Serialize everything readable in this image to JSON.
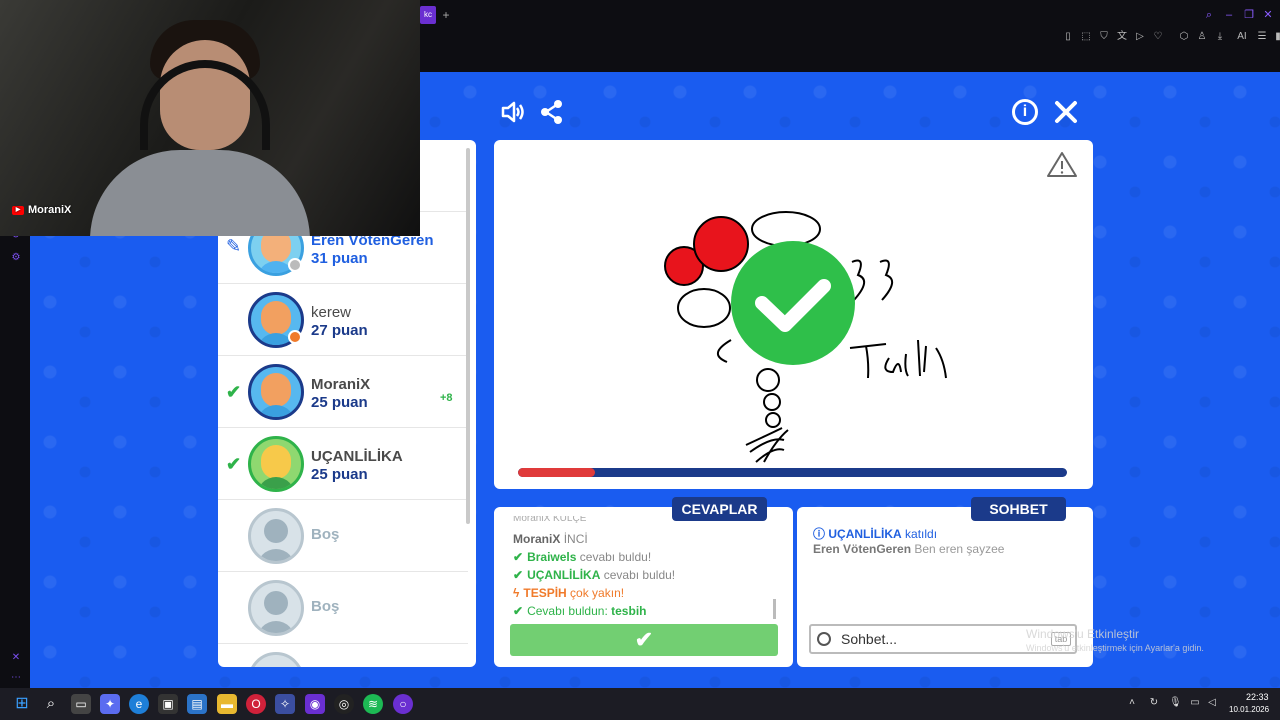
{
  "webcam": {
    "channel_name": "MoraniX"
  },
  "browser": {
    "tab_chip": "kc",
    "tab_plus": "+",
    "toolbar_ai": "AI"
  },
  "players": [
    {
      "name": "Eren VötenGeren",
      "score": "31 puan",
      "state": "drawing"
    },
    {
      "name": "kerew",
      "score": "27 puan",
      "state": "none"
    },
    {
      "name": "MoraniX",
      "score": "25 puan",
      "state": "guessed",
      "bonus": "+8"
    },
    {
      "name": "UÇANLİLİKA",
      "score": "25 puan",
      "state": "guessed"
    },
    {
      "name": "Boş"
    },
    {
      "name": "Boş"
    }
  ],
  "canvas": {
    "progress_fraction": 0.14,
    "drawing_word": "Taşlı",
    "drawing_number": "33"
  },
  "tabs": {
    "answers": "CEVAPLAR",
    "chat": "SOHBET"
  },
  "answers": {
    "partial_top": "MoraniX KÜLÇE",
    "messages": [
      {
        "name": "MoraniX",
        "text": "İNCİ",
        "type": "plain"
      },
      {
        "name": "Braiwels",
        "text": "cevabı buldu!",
        "type": "found"
      },
      {
        "name": "UÇANLİLİKA",
        "text": "cevabı buldu!",
        "type": "found"
      },
      {
        "name": "TESPİH",
        "text": "çok yakın!",
        "type": "close"
      },
      {
        "prefix": "Cevabı buldun:",
        "name": "tesbih",
        "type": "you_found"
      }
    ]
  },
  "chat": {
    "messages": [
      {
        "name": "UÇANLİLİKA",
        "text": "katıldı"
      },
      {
        "name": "Eren VötenGeren",
        "text": "Ben eren şayzee"
      }
    ],
    "placeholder": "Sohbet...",
    "tab_key": "tab"
  },
  "watermark": {
    "line1": "Windows'u Etkinleştir",
    "line2": "Windows'u etkinleştirmek için Ayarlar'a gidin."
  },
  "clock": {
    "time": "22:33",
    "date": "10.01.2026"
  },
  "colors": {
    "game_bg": "#1a5cf0",
    "navy": "#1b3a8a",
    "green": "#2fb34a",
    "orange": "#f07a2a"
  }
}
